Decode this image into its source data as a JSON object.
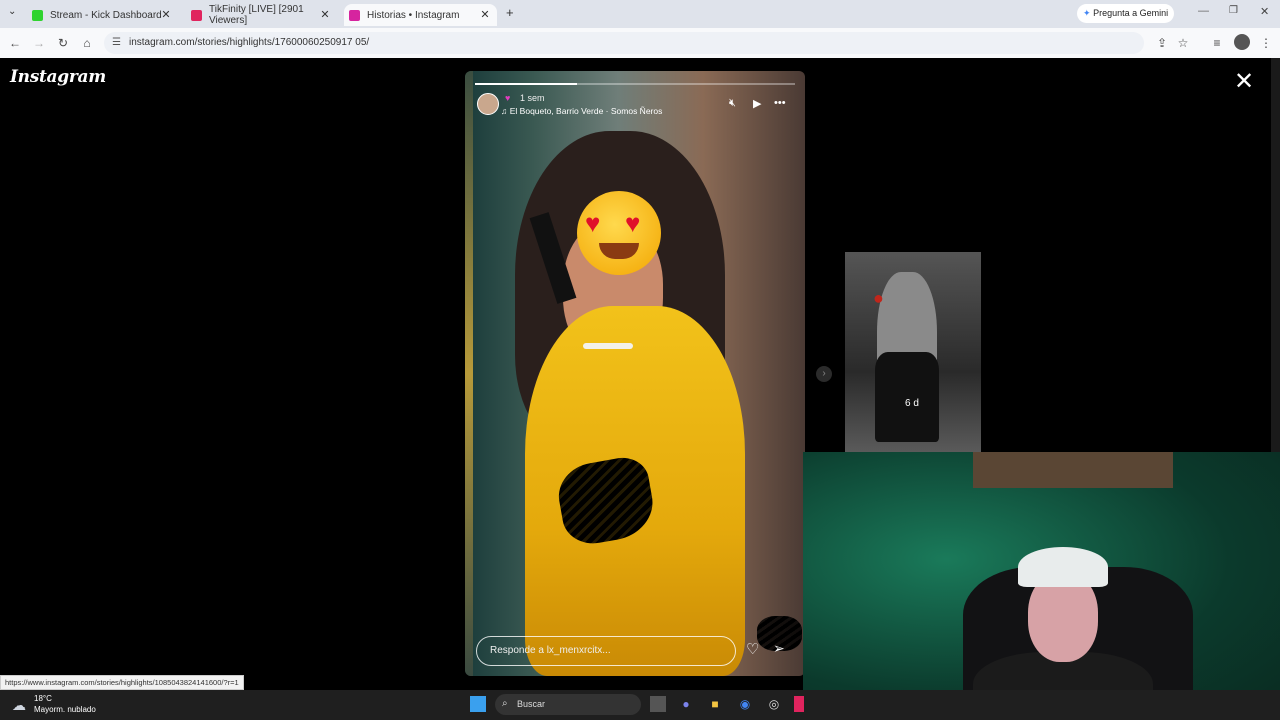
{
  "browser": {
    "tabs": [
      {
        "label": "Stream - Kick Dashboard",
        "active": false,
        "favicon_color": "#2fd32f"
      },
      {
        "label": "TikFinity [LIVE] [2901 Viewers]",
        "active": false,
        "favicon_color": "#e0245e"
      },
      {
        "label": "Historias • Instagram",
        "active": true,
        "favicon_color": "#d6249f"
      }
    ],
    "new_tab": "+",
    "gemini": "Pregunta a Gemini",
    "url": "instagram.com/stories/highlights/17600060250917 05/"
  },
  "instagram": {
    "logo": "Instagram",
    "close": "✕",
    "story": {
      "time": "1 sem",
      "song": "El Boqueto, Barrio Verde · Somos Ñeros",
      "reply_placeholder": "Responde a lx_menxrcitx...",
      "progress": 0.32
    },
    "preview": {
      "age": "6 d"
    }
  },
  "status_link": "https://www.instagram.com/stories/highlights/1085043824141600/?r=1",
  "taskbar": {
    "temperature": "18°C",
    "weather": "Mayorm. nublado",
    "search": "Buscar"
  }
}
